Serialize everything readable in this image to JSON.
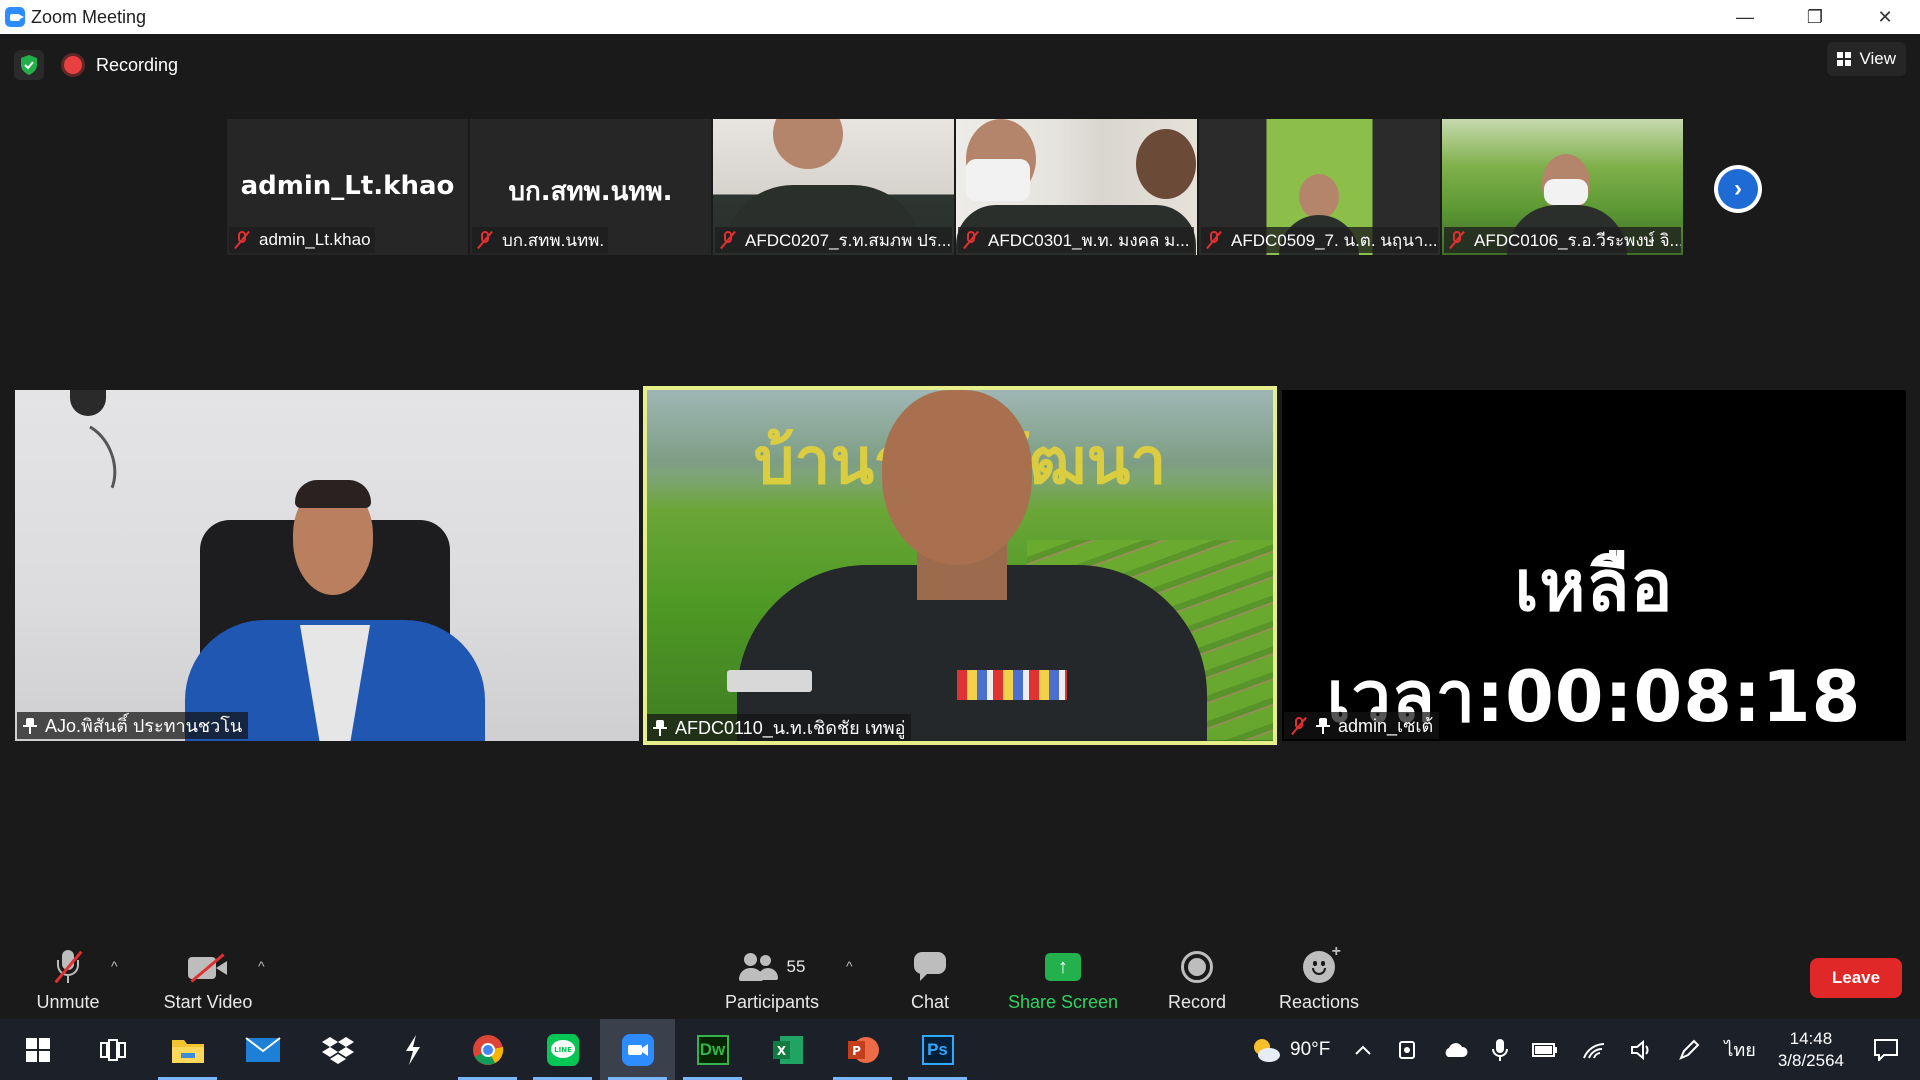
{
  "window": {
    "title": "Zoom Meeting",
    "controls": [
      "—",
      "❐",
      "✕"
    ]
  },
  "meeting": {
    "recording_label": "Recording",
    "view_label": "View"
  },
  "strip": [
    {
      "big_name": "admin_Lt.khao",
      "label": "admin_Lt.khao",
      "video": false
    },
    {
      "big_name": "บก.สทพ.นทพ.",
      "label": "บก.สทพ.นทพ.",
      "video": false
    },
    {
      "big_name": "",
      "label": "AFDC0207_ร.ท.สมภพ ปร...",
      "video": true
    },
    {
      "big_name": "",
      "label": "AFDC0301_พ.ท. มงคล ม...",
      "video": true
    },
    {
      "big_name": "",
      "label": "AFDC0509_7. น.ต. นฤนา...",
      "video": true
    },
    {
      "big_name": "",
      "label": "AFDC0106_ร.อ.วีระพงษ์ จิ...",
      "video": true
    }
  ],
  "tiles": [
    {
      "label": "AJo.พิสันติ์ ประทานชวโน"
    },
    {
      "label": "AFDC0110_น.ท.เชิดชัย เทพอู่",
      "banner": "บ้านรวมพัฒนา"
    },
    {
      "label": "admin_เซเต้",
      "countdown": "เหลือเวลา:00:08:18"
    }
  ],
  "controls": {
    "unmute": "Unmute",
    "start_video": "Start Video",
    "participants": "Participants",
    "participants_count": "55",
    "chat": "Chat",
    "share_screen": "Share Screen",
    "record": "Record",
    "reactions": "Reactions",
    "leave": "Leave",
    "caret": "^",
    "share_arrow": "↑"
  },
  "taskbar": {
    "weather": "90°F",
    "language": "ไทย",
    "time": "14:48",
    "date": "3/8/2564",
    "apps": [
      {
        "name": "Dw",
        "color": "#35b24a"
      },
      {
        "name": "Ps",
        "color": "#31a8ff"
      }
    ]
  },
  "colors": {
    "active_speaker_border": "#e6ef8a",
    "leave_red": "#e02828",
    "share_green": "#23b14d",
    "zoom_blue": "#2d8cff",
    "muted_red": "#e03030"
  }
}
